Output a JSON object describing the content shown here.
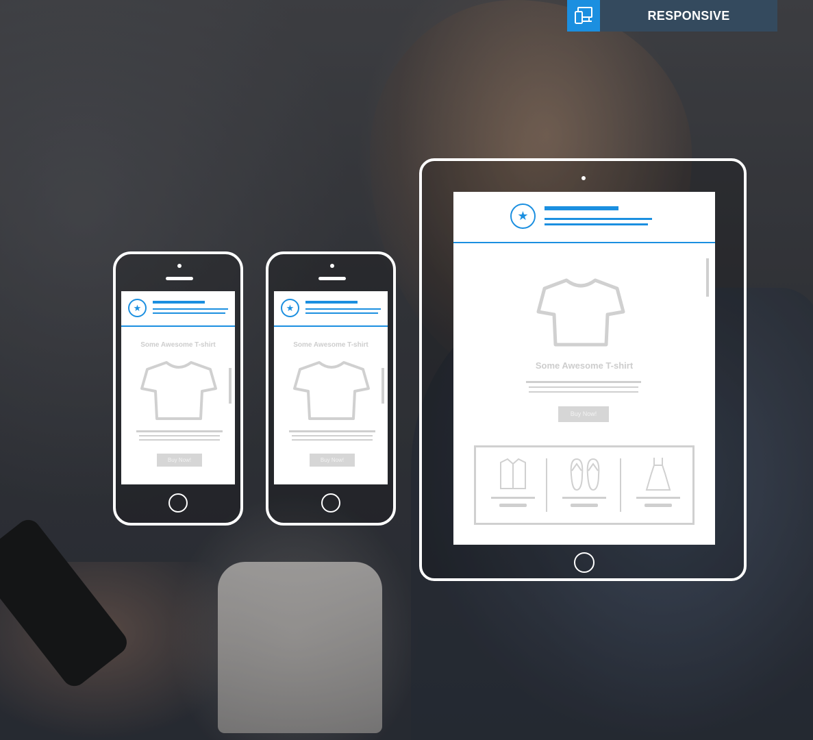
{
  "badge": {
    "label": "RESPONSIVE",
    "icon": "devices-icon",
    "icon_bg": "#1b8fe0",
    "bar_bg": "#344a5e"
  },
  "accent_color": "#1b8fe0",
  "phones": [
    {
      "title": "Some Awesome T-shirt",
      "button": "Buy Now!"
    },
    {
      "title": "Some Awesome T-shirt",
      "button": "Buy Now!"
    }
  ],
  "tablet": {
    "title": "Some Awesome T-shirt",
    "button": "Buy Now!",
    "related": [
      "shirt-icon",
      "flip-flops-icon",
      "dress-icon"
    ]
  }
}
